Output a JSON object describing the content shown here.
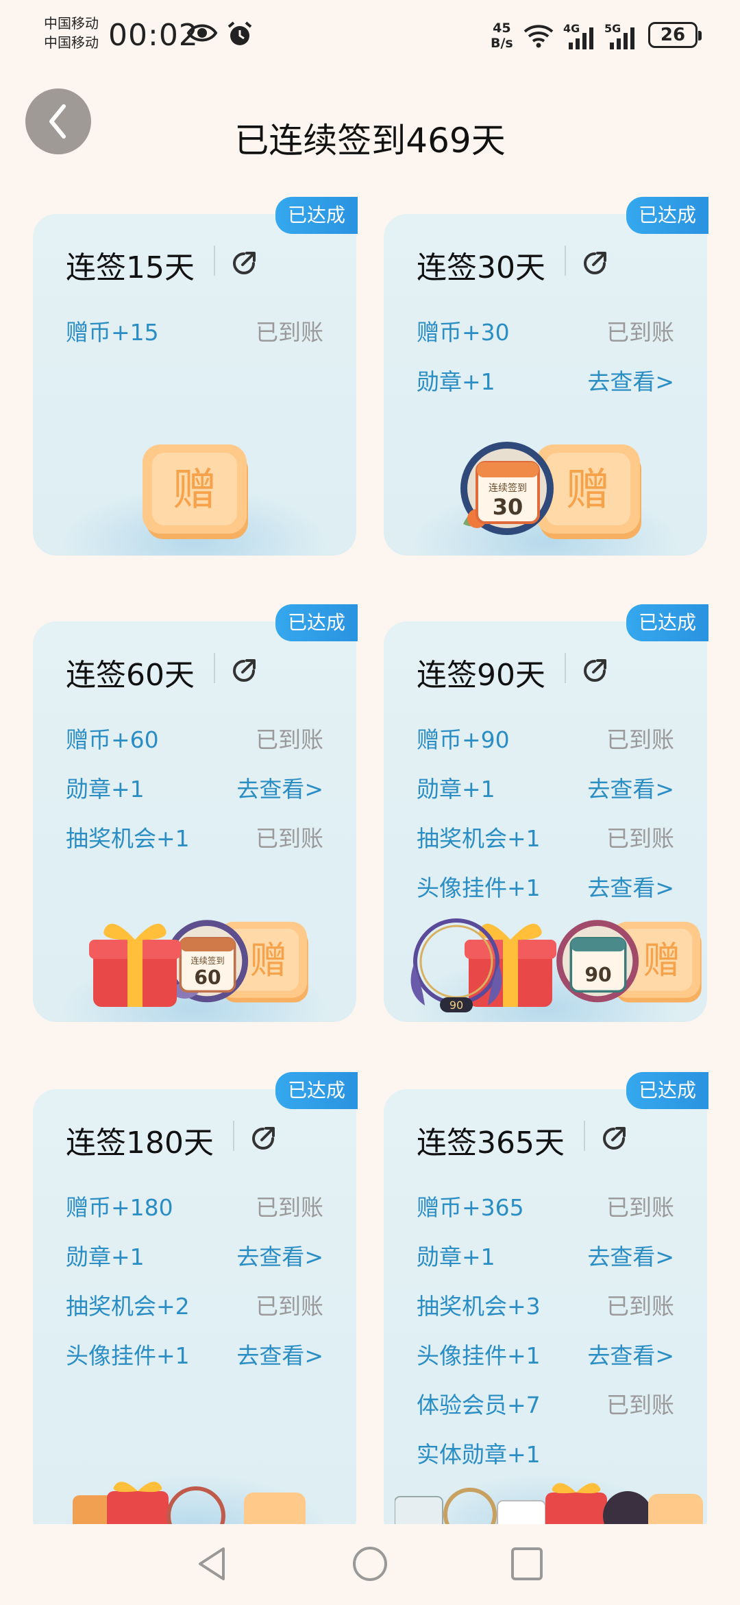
{
  "status_bar": {
    "carrier_1": "中国移动",
    "carrier_2": "中国移动",
    "time": "00:02",
    "net_speed_value": "45",
    "net_speed_unit": "B/s",
    "signal_1": "4G",
    "signal_2": "5G",
    "battery": "26",
    "icons": [
      "eye-icon",
      "alarm-icon",
      "wifi-icon",
      "signal-icon",
      "battery-icon"
    ]
  },
  "header": {
    "title": "已连续签到469天",
    "back_icon": "chevron-left-icon"
  },
  "cards": [
    {
      "badge": "已达成",
      "title": "连签15天",
      "rewards": [
        {
          "label": "赠币+15",
          "status": "已到账"
        }
      ]
    },
    {
      "badge": "已达成",
      "title": "连签30天",
      "badge_image_text": "连续签到",
      "badge_image_number": "30",
      "coin_text": "赠",
      "rewards": [
        {
          "label": "赠币+30",
          "status": "已到账"
        },
        {
          "label": "勋章+1",
          "status": "去查看>"
        }
      ]
    },
    {
      "badge": "已达成",
      "title": "连签60天",
      "badge_image_text": "连续签到",
      "badge_image_number": "60",
      "coin_text": "赠",
      "rewards": [
        {
          "label": "赠币+60",
          "status": "已到账"
        },
        {
          "label": "勋章+1",
          "status": "去查看>"
        },
        {
          "label": "抽奖机会+1",
          "status": "已到账"
        }
      ]
    },
    {
      "badge": "已达成",
      "title": "连签90天",
      "badge_image_number": "90",
      "frame_number": "90",
      "coin_text": "赠",
      "rewards": [
        {
          "label": "赠币+90",
          "status": "已到账"
        },
        {
          "label": "勋章+1",
          "status": "去查看>"
        },
        {
          "label": "抽奖机会+1",
          "status": "已到账"
        },
        {
          "label": "头像挂件+1",
          "status": "去查看>"
        }
      ]
    },
    {
      "badge": "已达成",
      "title": "连签180天",
      "rewards": [
        {
          "label": "赠币+180",
          "status": "已到账"
        },
        {
          "label": "勋章+1",
          "status": "去查看>"
        },
        {
          "label": "抽奖机会+2",
          "status": "已到账"
        },
        {
          "label": "头像挂件+1",
          "status": "去查看>"
        }
      ]
    },
    {
      "badge": "已达成",
      "title": "连签365天",
      "rewards": [
        {
          "label": "赠币+365",
          "status": "已到账"
        },
        {
          "label": "勋章+1",
          "status": "去查看>"
        },
        {
          "label": "抽奖机会+3",
          "status": "已到账"
        },
        {
          "label": "头像挂件+1",
          "status": "去查看>"
        },
        {
          "label": "体验会员+7",
          "status": "已到账"
        },
        {
          "label": "实体勋章+1",
          "status": ""
        }
      ]
    }
  ],
  "coin_glyph": "赠",
  "nav_bar": {
    "icons": [
      "back-triangle-icon",
      "home-circle-icon",
      "recents-square-icon"
    ]
  },
  "colors": {
    "page_bg": "#fdf6f0",
    "card_bg": "#e4f1f5",
    "badge_blue": "#2a93e0",
    "link_blue": "#2a8dc4",
    "muted_gray": "#9a9a9a"
  }
}
